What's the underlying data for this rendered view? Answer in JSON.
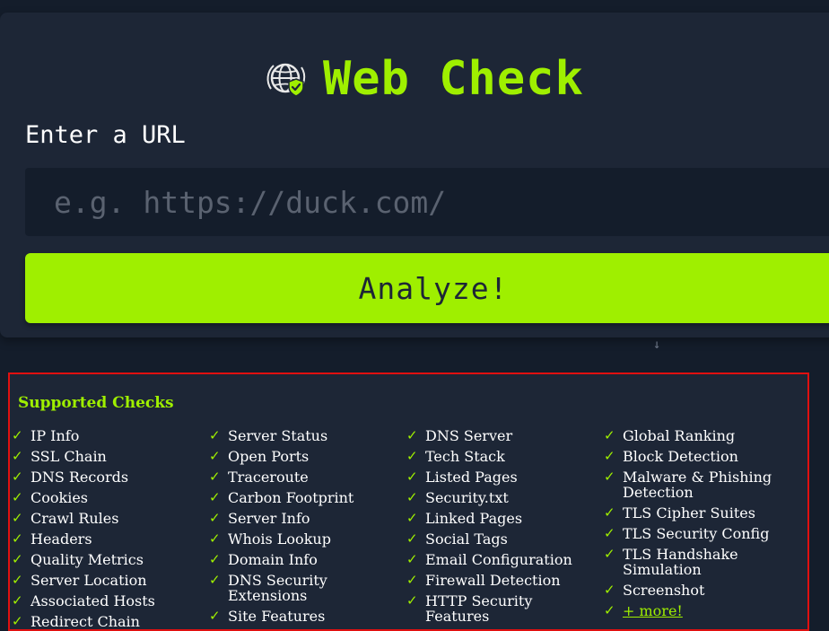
{
  "header": {
    "title": "Web Check"
  },
  "form": {
    "url_label": "Enter a URL",
    "url_placeholder": "e.g. https://duck.com/",
    "url_value": "",
    "analyze_label": "Analyze!"
  },
  "scroll_hint": {
    "arrow": "↓"
  },
  "checks": {
    "title": "Supported Checks",
    "tick": "✓",
    "columns": [
      [
        "IP Info",
        "SSL Chain",
        "DNS Records",
        "Cookies",
        "Crawl Rules",
        "Headers",
        "Quality Metrics",
        "Server Location",
        "Associated Hosts",
        "Redirect Chain"
      ],
      [
        "Server Status",
        "Open Ports",
        "Traceroute",
        "Carbon Footprint",
        "Server Info",
        "Whois Lookup",
        "Domain Info",
        "DNS Security Extensions",
        "Site Features"
      ],
      [
        "DNS Server",
        "Tech Stack",
        "Listed Pages",
        "Security.txt",
        "Linked Pages",
        "Social Tags",
        "Email Configuration",
        "Firewall Detection",
        "HTTP Security Features"
      ],
      [
        "Global Ranking",
        "Block Detection",
        "Malware & Phishing Detection",
        "TLS Cipher Suites",
        "TLS Security Config",
        "TLS Handshake Simulation",
        "Screenshot"
      ]
    ],
    "more_label": "+ more!"
  },
  "colors": {
    "accent": "#9fef00",
    "background": "#141d2b",
    "card": "#1d2636",
    "highlight_border": "#e01010"
  },
  "icons": {
    "logo": "globe-shield-icon",
    "check": "check-icon",
    "arrow": "arrow-down-icon"
  }
}
